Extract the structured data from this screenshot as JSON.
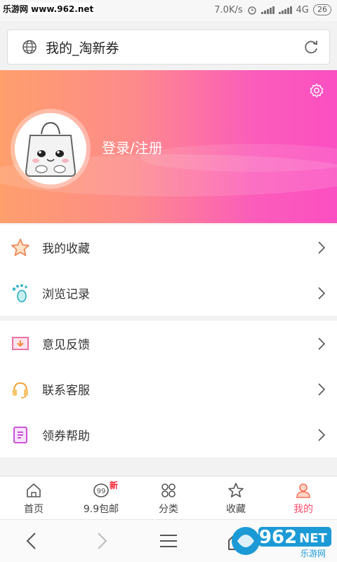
{
  "status_bar": {
    "watermark": "乐游网 www.962.net",
    "speed": "7.0K/s",
    "network": "4G",
    "battery": "26"
  },
  "url_bar": {
    "title": "我的_淘新券"
  },
  "profile": {
    "login_label": "登录/注册"
  },
  "menu_groups": [
    {
      "items": [
        {
          "label": "我的收藏",
          "icon": "star-icon"
        },
        {
          "label": "浏览记录",
          "icon": "footprint-icon"
        }
      ]
    },
    {
      "items": [
        {
          "label": "意见反馈",
          "icon": "feedback-icon"
        },
        {
          "label": "联系客服",
          "icon": "headset-icon"
        },
        {
          "label": "领券帮助",
          "icon": "help-doc-icon"
        }
      ]
    }
  ],
  "tabs": [
    {
      "label": "首页",
      "icon": "home-icon"
    },
    {
      "label": "9.9包邮",
      "icon": "free-shipping-icon",
      "badge": "新"
    },
    {
      "label": "分类",
      "icon": "category-icon"
    },
    {
      "label": "收藏",
      "icon": "star-outline-icon"
    },
    {
      "label": "我的",
      "icon": "user-icon",
      "active": true
    }
  ],
  "logo": {
    "text": "962",
    "suffix": "NET",
    "subtitle": "乐游网"
  },
  "colors": {
    "header_gradient_start": "#fe9f6c",
    "header_gradient_end": "#fb4fc2",
    "active_tab": "#fb4f6f"
  }
}
